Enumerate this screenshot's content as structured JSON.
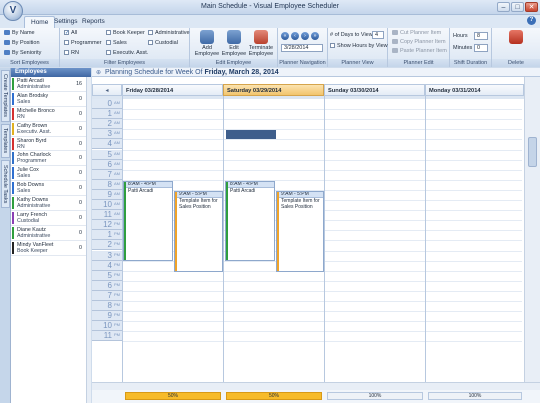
{
  "window": {
    "title": "Main Schedule - Visual Employee Scheduler",
    "app_orb": "V"
  },
  "tabs": [
    "Home",
    "Settings",
    "Reports"
  ],
  "help_icon": "?",
  "ribbon": {
    "sort": {
      "label": "Sort Employees",
      "items": [
        "By Name",
        "By Position",
        "By Seniority"
      ]
    },
    "filter": {
      "label": "Filter Employees",
      "col1": [
        "All",
        "Programmer",
        "RN"
      ],
      "col2": [
        "Book Keeper",
        "Sales",
        "Executiv. Asst."
      ],
      "col3": [
        "Administrative",
        "Custodial"
      ]
    },
    "edit_employee": {
      "label": "Edit Employee",
      "buttons": [
        "Add\nEmployee",
        "Edit\nEmployee",
        "Terminate\nEmployee"
      ]
    },
    "navigation": {
      "label": "Planner Navigation",
      "date": "3/28/2014"
    },
    "view": {
      "label": "Planner View",
      "days_label": "# of Days to View",
      "days_value": "4",
      "show_hours": "Show Hours by View"
    },
    "planner_edit": {
      "label": "Planner Edit",
      "items": [
        "Cut Planner Item",
        "Copy Planner Item",
        "Paste Planner Item"
      ]
    },
    "shift": {
      "label": "Shift Duration",
      "hours_label": "Hours",
      "hours_value": "8",
      "minutes_label": "Minutes",
      "minutes_value": "0"
    },
    "delete": {
      "label": "Delete"
    }
  },
  "side_tabs": [
    "Create Templates",
    "Templates",
    "Schedule Tasks"
  ],
  "employees_header": "Employees",
  "employees": [
    {
      "name": "Patti Arcadi",
      "role": "Administrative",
      "count": "16",
      "color": "#2f9e3e"
    },
    {
      "name": "Alan Brodsky",
      "role": "Sales",
      "count": "0",
      "color": "#2f6fd0"
    },
    {
      "name": "Michelle Bronco",
      "role": "RN",
      "count": "0",
      "color": "#d43131"
    },
    {
      "name": "Cathy Brown",
      "role": "Executiv. Asst.",
      "count": "0",
      "color": "#e0b020"
    },
    {
      "name": "Sharon Byrd",
      "role": "RN",
      "count": "0",
      "color": "#d43131"
    },
    {
      "name": "John Charlock",
      "role": "Programmer",
      "count": "0",
      "color": "#3070c8"
    },
    {
      "name": "Julie Cox",
      "role": "Sales",
      "count": "0",
      "color": "#2f6fd0"
    },
    {
      "name": "Bob Downs",
      "role": "Sales",
      "count": "0",
      "color": "#2f6fd0"
    },
    {
      "name": "Kathy Downs",
      "role": "Administrative",
      "count": "0",
      "color": "#2f9e3e"
    },
    {
      "name": "Larry French",
      "role": "Custodial",
      "count": "0",
      "color": "#8b3fb5"
    },
    {
      "name": "Diane Kautz",
      "role": "Administrative",
      "count": "0",
      "color": "#2f9e3e"
    },
    {
      "name": "Mindy VanFleet",
      "role": "Book Keeper",
      "count": "0",
      "color": "#222222"
    }
  ],
  "schedule": {
    "title_prefix": "Planning Schedule for Week Of",
    "title_date": "Friday, March 28, 2014",
    "days": [
      "Friday 03/28/2014",
      "Saturday 03/29/2014",
      "Sunday 03/30/2014",
      "Monday 03/31/2014"
    ],
    "hours": [
      {
        "n": "0",
        "s": "AM"
      },
      {
        "n": "1",
        "s": "AM"
      },
      {
        "n": "2",
        "s": "AM"
      },
      {
        "n": "3",
        "s": "AM"
      },
      {
        "n": "4",
        "s": "AM"
      },
      {
        "n": "5",
        "s": "AM"
      },
      {
        "n": "6",
        "s": "AM"
      },
      {
        "n": "7",
        "s": "AM"
      },
      {
        "n": "8",
        "s": "AM"
      },
      {
        "n": "9",
        "s": "AM"
      },
      {
        "n": "10",
        "s": "AM"
      },
      {
        "n": "11",
        "s": "AM"
      },
      {
        "n": "12",
        "s": "PM"
      },
      {
        "n": "1",
        "s": "PM"
      },
      {
        "n": "2",
        "s": "PM"
      },
      {
        "n": "3",
        "s": "PM"
      },
      {
        "n": "4",
        "s": "PM"
      },
      {
        "n": "5",
        "s": "PM"
      },
      {
        "n": "6",
        "s": "PM"
      },
      {
        "n": "7",
        "s": "PM"
      },
      {
        "n": "8",
        "s": "PM"
      },
      {
        "n": "9",
        "s": "PM"
      },
      {
        "n": "10",
        "s": "PM"
      },
      {
        "n": "11",
        "s": "PM"
      }
    ],
    "events": [
      {
        "time": "8:AM - 4:PM",
        "text": "Patti Arcadi"
      },
      {
        "time": "9:AM - 5:PM",
        "text": "Template Item for Sales Position"
      },
      {
        "time": "8:AM - 4:PM",
        "text": "Patti Arcadi"
      },
      {
        "time": "9:AM - 5:PM",
        "text": "Template Item for Sales Position"
      }
    ],
    "footer_percents": [
      "50%",
      "50%",
      "100%",
      "100%"
    ]
  }
}
